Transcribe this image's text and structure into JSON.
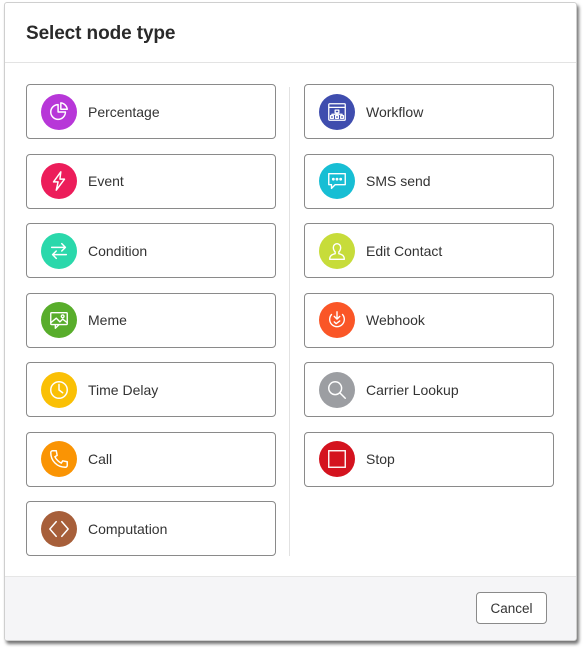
{
  "dialog": {
    "title": "Select node type",
    "cancel_label": "Cancel"
  },
  "left_column": [
    {
      "label": "Percentage",
      "icon": "pie-chart-icon",
      "color": "#b737d8"
    },
    {
      "label": "Event",
      "icon": "lightning-icon",
      "color": "#ec1d5a"
    },
    {
      "label": "Condition",
      "icon": "arrows-swap-icon",
      "color": "#2ad8ab"
    },
    {
      "label": "Meme",
      "icon": "image-chat-icon",
      "color": "#58ad2b"
    },
    {
      "label": "Time Delay",
      "icon": "clock-icon",
      "color": "#fac005"
    },
    {
      "label": "Call",
      "icon": "phone-icon",
      "color": "#fa9404"
    },
    {
      "label": "Computation",
      "icon": "code-brackets-icon",
      "color": "#a75f3a"
    }
  ],
  "right_column": [
    {
      "label": "Workflow",
      "icon": "workflow-window-icon",
      "color": "#3f4dae"
    },
    {
      "label": "SMS send",
      "icon": "chat-bubble-icon",
      "color": "#17bed4"
    },
    {
      "label": "Edit Contact",
      "icon": "contact-person-icon",
      "color": "#c7dc3a"
    },
    {
      "label": "Webhook",
      "icon": "webhook-icon",
      "color": "#fa5627"
    },
    {
      "label": "Carrier Lookup",
      "icon": "magnifier-icon",
      "color": "#9c9ea2"
    },
    {
      "label": "Stop",
      "icon": "stop-square-icon",
      "color": "#d4131f"
    }
  ]
}
